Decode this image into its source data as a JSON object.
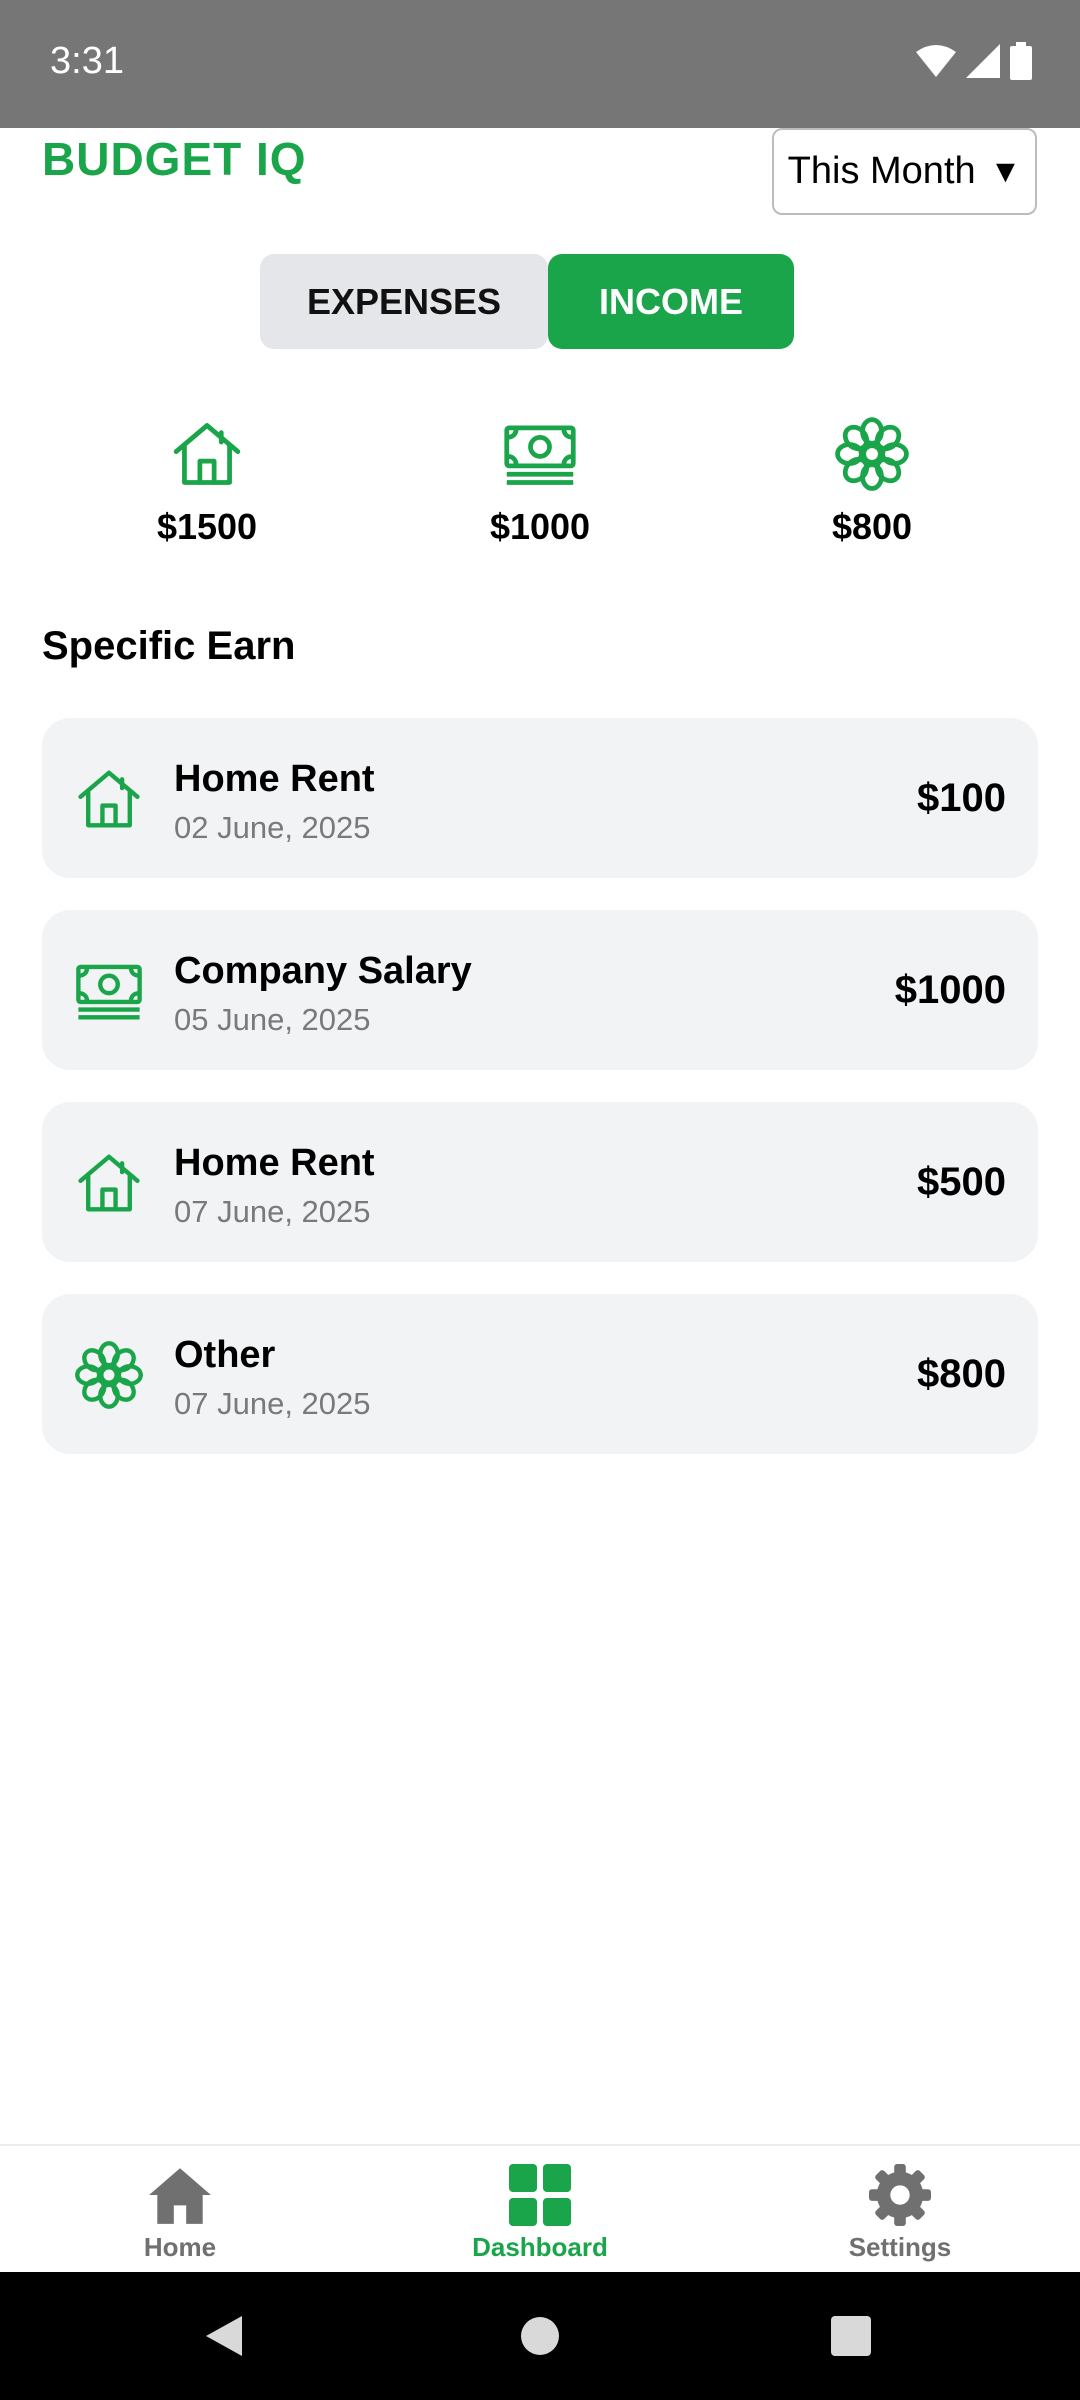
{
  "status": {
    "time": "3:31"
  },
  "header": {
    "title": "BUDGET IQ",
    "period_label": "This Month",
    "period_arrow": "▼"
  },
  "tabs": [
    {
      "label": "EXPENSES",
      "active": false
    },
    {
      "label": "INCOME",
      "active": true
    }
  ],
  "summary": [
    {
      "icon": "house-icon",
      "amount": "$1500"
    },
    {
      "icon": "cash-icon",
      "amount": "$1000"
    },
    {
      "icon": "flower-icon",
      "amount": "$800"
    }
  ],
  "section_title": "Specific Earn",
  "transactions": [
    {
      "icon": "house-icon",
      "name": "Home Rent",
      "date": "02 June, 2025",
      "amount": "$100"
    },
    {
      "icon": "cash-icon",
      "name": "Company Salary",
      "date": "05 June, 2025",
      "amount": "$1000"
    },
    {
      "icon": "house-icon",
      "name": "Home Rent",
      "date": "07 June, 2025",
      "amount": "$500"
    },
    {
      "icon": "flower-icon",
      "name": "Other",
      "date": "07 June, 2025",
      "amount": "$800"
    }
  ],
  "bottom_nav": [
    {
      "label": "Home",
      "icon": "home-icon",
      "active": false
    },
    {
      "label": "Dashboard",
      "icon": "dashboard-icon",
      "active": true
    },
    {
      "label": "Settings",
      "icon": "gear-icon",
      "active": false
    }
  ],
  "colors": {
    "accent": "#1aa54a",
    "status_bar": "#767676",
    "card_bg": "#f2f3f5",
    "tab_inactive": "#e5e6e9"
  }
}
